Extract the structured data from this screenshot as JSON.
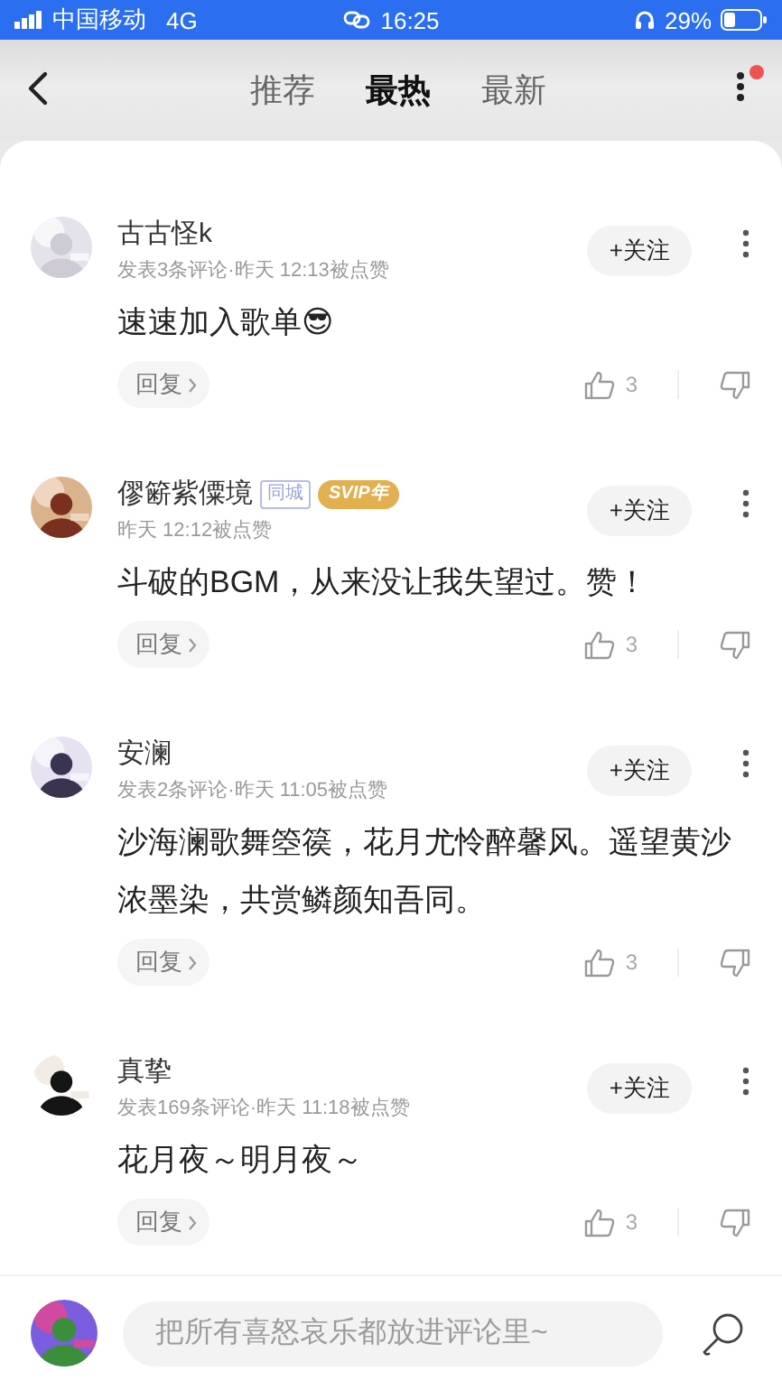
{
  "status_bar": {
    "carrier": "中国移动",
    "network": "4G",
    "time": "16:25",
    "battery": "29%"
  },
  "nav": {
    "tabs": [
      {
        "label": "推荐",
        "selected": false
      },
      {
        "label": "最热",
        "selected": true
      },
      {
        "label": "最新",
        "selected": false
      }
    ],
    "has_notification": true
  },
  "comments": [
    {
      "user": "古古怪k",
      "meta": "发表3条评论·昨天 12:13被点赞",
      "text": "速速加入歌单😎",
      "follow": "+关注",
      "reply": "回复",
      "likes": "3"
    },
    {
      "user": "僇簖紫僳境",
      "badges": [
        {
          "kind": "outline",
          "label": "同城"
        },
        {
          "kind": "svip",
          "label": "SVIP年"
        }
      ],
      "meta": "昨天 12:12被点赞",
      "text": "斗破的BGM，从来没让我失望过。赞！",
      "follow": "+关注",
      "reply": "回复",
      "likes": "3"
    },
    {
      "user": "安澜",
      "meta": "发表2条评论·昨天 11:05被点赞",
      "text": "沙海澜歌舞箜篌，花月尤怜醉馨风。遥望黄沙浓墨染，共赏鳞颜知吾同。",
      "follow": "+关注",
      "reply": "回复",
      "likes": "3"
    },
    {
      "user": "真挚",
      "meta": "发表169条评论·昨天 11:18被点赞",
      "text": "花月夜～明月夜～",
      "follow": "+关注",
      "reply": "回复",
      "likes": "3"
    }
  ],
  "composer": {
    "placeholder": "把所有喜怒哀乐都放进评论里~"
  }
}
